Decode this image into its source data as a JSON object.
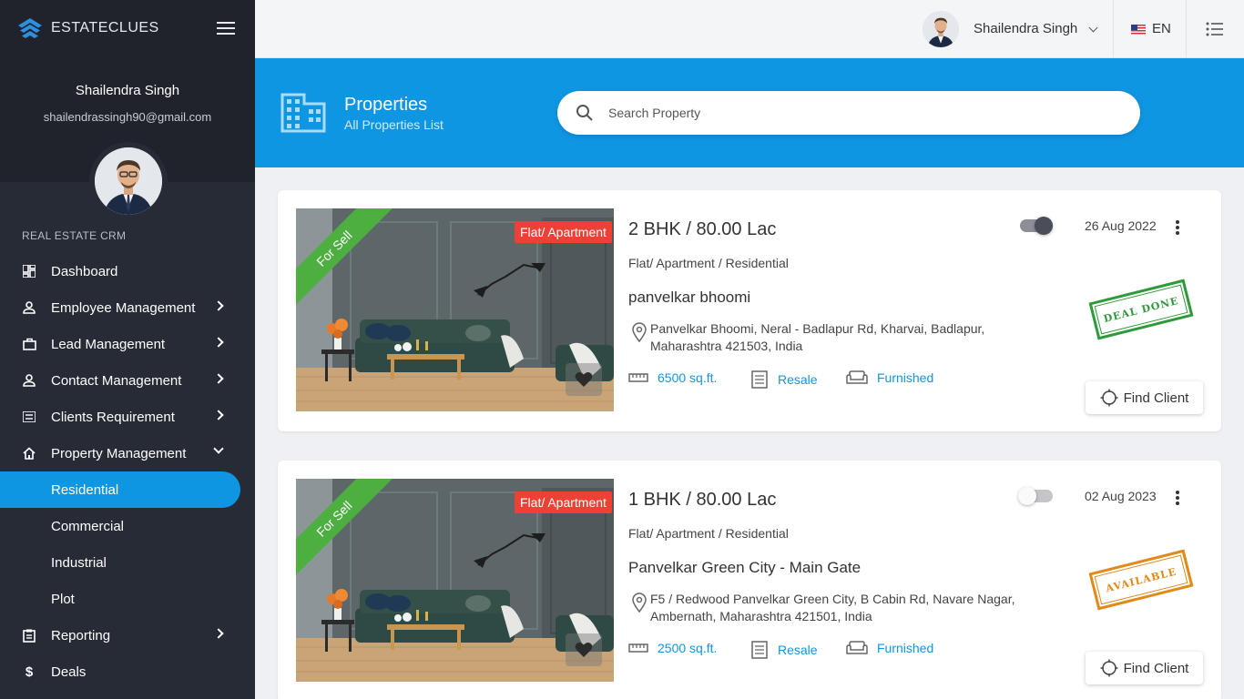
{
  "app": {
    "brand": "ESTATECLUES"
  },
  "sidebar": {
    "user_name": "Shailendra Singh",
    "user_email": "shailendrassingh90@gmail.com",
    "section": "REAL ESTATE CRM",
    "items": [
      {
        "label": "Dashboard",
        "icon": "dashboard-icon"
      },
      {
        "label": "Employee Management",
        "icon": "person-icon"
      },
      {
        "label": "Lead Management",
        "icon": "briefcase-icon"
      },
      {
        "label": "Contact Management",
        "icon": "person-icon"
      },
      {
        "label": "Clients Requirement",
        "icon": "list-icon"
      },
      {
        "label": "Property Management",
        "icon": "home-icon"
      }
    ],
    "sub_items": [
      "Residential",
      "Commercial",
      "Industrial",
      "Plot"
    ],
    "active_sub": "Residential",
    "bottom_items": [
      {
        "label": "Reporting",
        "icon": "clipboard-icon"
      },
      {
        "label": "Deals",
        "icon": "dollar-icon"
      }
    ]
  },
  "topbar": {
    "user_name": "Shailendra Singh",
    "language": "EN"
  },
  "header": {
    "title": "Properties",
    "subtitle": "All Properties List",
    "search_placeholder": "Search Property"
  },
  "properties": [
    {
      "ribbon": "For Sell",
      "type_badge": "Flat/ Apartment",
      "title": "2 BHK / 80.00 Lac",
      "subtitle": "Flat/ Apartment / Residential",
      "project": "panvelkar bhoomi",
      "address": "Panvelkar Bhoomi, Neral - Badlapur Rd, Kharvai, Badlapur, Maharashtra 421503, India",
      "area": "6500 sq.ft.",
      "listing": "Resale",
      "furnishing": "Furnished",
      "date": "26 Aug 2022",
      "active": true,
      "stamp": "DEAL DONE",
      "stamp_color": "#2f9a3a",
      "button": "Find Client"
    },
    {
      "ribbon": "For Sell",
      "type_badge": "Flat/ Apartment",
      "title": "1 BHK / 80.00 Lac",
      "subtitle": "Flat/ Apartment / Residential",
      "project": "Panvelkar Green City - Main Gate",
      "address": "F5 / Redwood Panvelkar Green City, B Cabin Rd, Navare Nagar, Ambernath, Maharashtra 421501, India",
      "area": "2500 sq.ft.",
      "listing": "Resale",
      "furnishing": "Furnished",
      "date": "02 Aug 2023",
      "active": false,
      "stamp": "AVAILABLE",
      "stamp_color": "#e08a1a",
      "button": "Find Client"
    }
  ],
  "colors": {
    "accent": "#0f96e3",
    "sidebar": "#272b35",
    "ribbon": "#4caf3f",
    "badge": "#ef4036"
  }
}
